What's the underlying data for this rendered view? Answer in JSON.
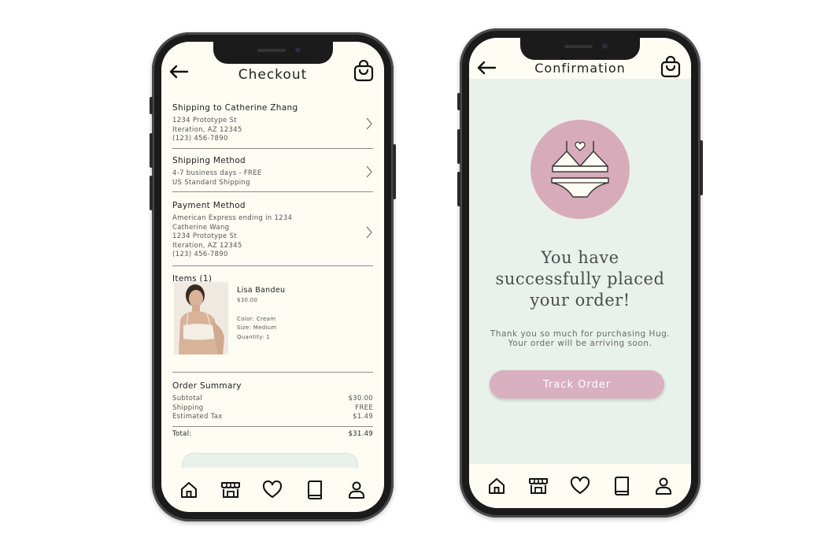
{
  "checkout": {
    "title": "Checkout",
    "shipping": {
      "title": "Shipping to Catherine Zhang",
      "lines": [
        "1234 Prototype St",
        "Iteration, AZ 12345",
        "(123) 456-7890"
      ]
    },
    "method": {
      "title": "Shipping Method",
      "lines": [
        "4-7 business days - FREE",
        "US Standard Shipping"
      ]
    },
    "payment": {
      "title": "Payment Method",
      "lines": [
        "American Express ending in 1234",
        "Catherine Wang",
        "1234 Prototype St",
        "Iteration, AZ 12345",
        "(123) 456-7890"
      ]
    },
    "items": {
      "title": "Items (1)",
      "name": "Lisa Bandeu",
      "price": "$30.00",
      "color": "Color: Cream",
      "size": "Size: Medium",
      "quantity": "Quantity: 1"
    },
    "summary": {
      "title": "Order Summary",
      "rows": [
        {
          "label": "Subtotal",
          "value": "$30.00"
        },
        {
          "label": "Shipping",
          "value": "FREE"
        },
        {
          "label": "Estimated Tax",
          "value": "$1.49"
        }
      ],
      "total_label": "Total:",
      "total_value": "$31.49"
    }
  },
  "confirmation": {
    "title": "Confirmation",
    "headline": [
      "You have",
      "successfully placed",
      "your order!"
    ],
    "thanks": [
      "Thank you so much for purchasing Hug.",
      "Your order will be arriving soon."
    ],
    "track_label": "Track Order"
  },
  "colors": {
    "cream": "#fefcf3",
    "mint": "#e9f2ea",
    "pink": "#d8abbb"
  },
  "tabbar": [
    "home-icon",
    "store-icon",
    "heart-icon",
    "book-icon",
    "profile-icon"
  ]
}
